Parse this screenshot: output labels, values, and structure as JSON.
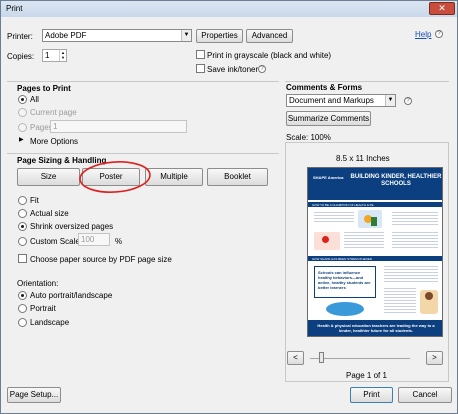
{
  "window": {
    "title": "Print",
    "close": "✕"
  },
  "printer": {
    "label": "Printer:",
    "value": "Adobe PDF",
    "properties": "Properties",
    "advanced": "Advanced",
    "help": "Help"
  },
  "copies": {
    "label": "Copies:",
    "value": "1"
  },
  "options": {
    "grayscale": "Print in grayscale (black and white)",
    "ink": "Save ink/toner"
  },
  "pages": {
    "title": "Pages to Print",
    "all": "All",
    "current": "Current page",
    "pages": "Pages",
    "pages_value": "1",
    "more": "More Options"
  },
  "sizing": {
    "title": "Page Sizing & Handling",
    "tabs": [
      "Size",
      "Poster",
      "Multiple",
      "Booklet"
    ],
    "fit": "Fit",
    "actual": "Actual size",
    "shrink": "Shrink oversized pages",
    "custom": "Custom Scale:",
    "custom_value": "100",
    "percent": "%",
    "source": "Choose paper source by PDF page size"
  },
  "orientation": {
    "title": "Orientation:",
    "auto": "Auto portrait/landscape",
    "portrait": "Portrait",
    "landscape": "Landscape"
  },
  "comments": {
    "title": "Comments & Forms",
    "value": "Document and Markups",
    "summarize": "Summarize Comments"
  },
  "preview": {
    "scale": "Scale: 100%",
    "size": "8.5 x 11 Inches",
    "page": "Page 1 of 1",
    "prev": "<",
    "next": ">",
    "doc": {
      "brand": "SHAPE America",
      "headline": "BUILDING KINDER, HEALTHIER SCHOOLS",
      "band1": "HOW TO BE A CHAMPION OF HEALTH & PE",
      "band2": "HOW SHAPE HAS BEEN STRENGTHENED",
      "callout": "Schools can influence healthy behaviors—and active, healthy students are better learners",
      "footer": "Health & physical education teachers are leading the way to a kinder, healthier future for all students."
    }
  },
  "footer": {
    "setup": "Page Setup...",
    "print": "Print",
    "cancel": "Cancel"
  },
  "colors": {
    "poster_blue": "#0b3f7f",
    "annotation_red": "#e0201c"
  }
}
